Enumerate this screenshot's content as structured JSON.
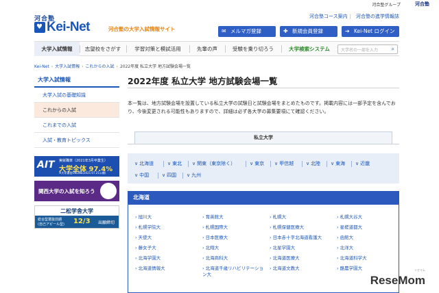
{
  "topbar": {
    "group_label": "河合塾グループ",
    "group_logo": "河合塾"
  },
  "header": {
    "brand_ja": "河合塾",
    "logo_text": "Kei-Net",
    "tagline": "河合塾の大学入試情報サイト",
    "links": [
      "河合塾コース案内",
      "河合塾の進学情報誌"
    ],
    "buttons": [
      {
        "label": "メルマガ登録",
        "icon": "mail-icon"
      },
      {
        "label": "新規会員登録",
        "icon": "user-add-icon"
      },
      {
        "label": "Kei-Net ログイン",
        "icon": "login-icon"
      }
    ]
  },
  "nav": {
    "items": [
      "大学入試情報",
      "志望校をさがす",
      "学習対策と模試活用",
      "先輩の声",
      "受験を乗り切ろう",
      "大学検索システム"
    ],
    "search_placeholder": "大学名の一部を入力"
  },
  "breadcrumb": [
    "Kei-Net",
    "大学入試情報",
    "これからの入試",
    "2022年度 私立大学 地方試験会場一覧"
  ],
  "sidebar": {
    "title": "大学入試情報",
    "items": [
      "大学入試の基礎知識",
      "これからの入試",
      "これまでの入試",
      "入試・教育トピックス"
    ],
    "active_index": 1
  },
  "banners": {
    "ait": {
      "logo": "AIT",
      "line1": "実就職率（2021年3月卒業生）",
      "rate": "大学全体 97.4%",
      "line3": "※大学通信ONLINE(2021.07.21公開)"
    },
    "kansai": {
      "text": "関西大学の入試を知ろう"
    },
    "nisho": {
      "title": "二松学舎大学",
      "line1": "総合型選抜前期",
      "line2": "(自己アピール型)",
      "date": "12/3",
      "end": "出願締切"
    }
  },
  "main": {
    "title": "2022年度 私立大学 地方試験会場一覧",
    "intro": "本一覧は、地方試験会場を設置している私立大学の試験日と試験会場をまとめたものです。掲載内容には一部予定を含んでおり、今後変更される可能性もありますので、詳細は必ず各大学の募集要項にて確認ください。",
    "tab": "私立大学",
    "regions": [
      "北海道",
      "東北",
      "関東（東京除く）",
      "東京",
      "甲信越",
      "北陸",
      "東海",
      "近畿",
      "中国",
      "四国",
      "九州"
    ],
    "pref_heading": "北海道",
    "universities": [
      "旭川大",
      "育英館大",
      "札幌大",
      "札幌大谷大",
      "札幌学院大",
      "札幌国際大",
      "札幌保健医療大",
      "星槎道都大",
      "天使大",
      "日本医療大",
      "日本赤十字北海道看護大",
      "函館大",
      "藤女子大",
      "北翔大",
      "北星学園大",
      "北洋大",
      "北海学園大",
      "北海商科大",
      "北海道医療大",
      "北海道科学大",
      "北海道情報大",
      "北海道千歳リハビリテーション大",
      "北海道文教大",
      "酪農学園大"
    ]
  },
  "watermark": {
    "text": "ReseMom",
    "small": "リセマム"
  }
}
